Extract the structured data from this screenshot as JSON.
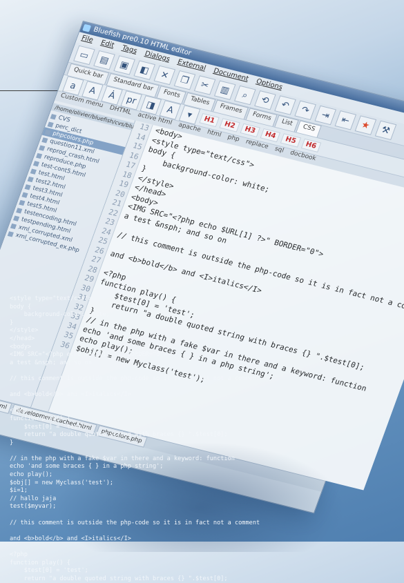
{
  "window": {
    "title": "Bluefish pre0.10 HTML editor",
    "menu": [
      "File",
      "Edit",
      "Tags",
      "Dialogs",
      "External",
      "Document",
      "Options"
    ],
    "quick_tabs": [
      "Quick bar",
      "Standard bar",
      "Fonts",
      "Tables",
      "Frames",
      "Forms",
      "List",
      "CSS"
    ],
    "sub_tabs": [
      "Custom menu",
      "DHTML",
      "active html",
      "apache",
      "html",
      "php",
      "replace",
      "sql",
      "docbook"
    ],
    "heading_buttons": [
      "H1",
      "H2",
      "H3",
      "H4",
      "H5",
      "H6"
    ],
    "tree_path": "/home/olivier/bluefish/cvs/blue",
    "files": [
      "CVS",
      "perc_dict",
      "phpcolors.php",
      "question11.xml",
      "reprod_crash.html",
      "reproduce.php",
      "test-cont5.html",
      "test.html",
      "test2.html",
      "test3.html",
      "test4.html",
      "test5.html",
      "testencoding.html",
      "testpending.html",
      "xml_corrupted.xml",
      "xml_corrupted_ex.php"
    ],
    "selected_file_index": 2,
    "doc_tabs": [
      "testencoding.html",
      "development.cached.html",
      "phpcolors.php"
    ]
  },
  "editor": {
    "line_numbers": [
      "13",
      "14",
      "15",
      "16",
      "17",
      "18",
      "19",
      "20",
      "21",
      "22",
      "23",
      "24",
      "25",
      "26",
      "27",
      "28",
      "29",
      "30",
      "31",
      "32",
      "33",
      "34",
      "35",
      "36"
    ],
    "lines": [
      "<body>",
      "<style type=\"text/css\">",
      "body {",
      "    background-color: white;",
      "}",
      "</style>",
      "</head>",
      "<body>",
      "<IMG SRC=\"<?php echo $URL[1] ?>\" BORDER=\"0\">",
      "a test &nsph; and so on",
      "",
      "// this comment is outside the php-code so it is in fact not a comment",
      "",
      "and <b>bold</b> and <I>italics</I>",
      "",
      "<?php",
      "function play() {",
      "    $test[0] = 'test';",
      "    return \"a double quoted string with braces {} \".$test[0];",
      "}",
      "// in the php with a fake $var in there and a keyword: function",
      "echo 'and some braces { } in a php string';",
      "echo play();",
      "$obj[] = new Myclass('test');"
    ]
  },
  "overlay_lines": [
    "<style type=\"text/css\">",
    "body {",
    "    background-color: white;",
    "}",
    "</style>",
    "</head>",
    "<body>",
    "<IMG SRC=\"<?php echo $URL[1] ?>\" BORDER=\"0\">",
    "a test &nsph; and so on",
    "",
    "// this comment is outside the php-code so it is in fact not a comment",
    "",
    "and <b>bold</b> and <I>italics</I>",
    "",
    "<?php",
    "function play() {",
    "    $test[0] = 'test';",
    "    return \"a double quoted string with braces {} \".$test[0];",
    "}",
    "",
    "// in the php with a fake $var in there and a keyword: function",
    "echo 'and some braces { } in a php string';",
    "echo play();",
    "$obj[] = new Myclass('test');",
    "$i=1;",
    "// hallo jaja",
    "test($myvar);",
    "",
    "// this comment is outside the php-code so it is in fact not a comment",
    "",
    "and <b>bold</b> and <I>italics</I>",
    "",
    "<?php",
    "function play() {",
    "    $test[0] = 'test';",
    "    return \"a double quoted string with braces {} \".$test[0];"
  ],
  "colors": {
    "heading_button": "#c42020",
    "bookmark_star": "#e0401e",
    "selected_file": "#7f9fc4"
  }
}
